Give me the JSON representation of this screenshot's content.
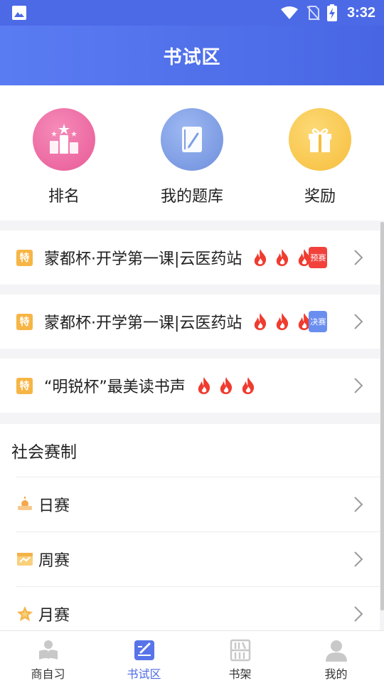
{
  "status_bar": {
    "time": "3:32"
  },
  "header": {
    "title": "书试区"
  },
  "quick_actions": [
    {
      "label": "排名",
      "icon": "podium-stars-icon",
      "color": "#ee6ea5"
    },
    {
      "label": "我的题库",
      "icon": "notebook-pen-icon",
      "color": "#7d9fe6"
    },
    {
      "label": "奖励",
      "icon": "gift-box-icon",
      "color": "#f9c84d"
    }
  ],
  "contests": [
    {
      "tag": "特",
      "title": "蒙都杯·开学第一课|云医药站",
      "flames": 3,
      "badge": "预赛",
      "badge_color": "#f2413b"
    },
    {
      "tag": "特",
      "title": "蒙都杯·开学第一课|云医药站",
      "flames": 3,
      "badge": "决赛",
      "badge_color": "#6a8ef0"
    },
    {
      "tag": "特",
      "title": "“明锐杯”最美读书声",
      "flames": 3,
      "badge": "",
      "badge_color": ""
    }
  ],
  "social": {
    "title": "社会赛制",
    "items": [
      {
        "label": "日赛",
        "icon": "sunrise-icon"
      },
      {
        "label": "周赛",
        "icon": "calendar-week-icon"
      },
      {
        "label": "月赛",
        "icon": "star-medal-icon"
      }
    ]
  },
  "tabs": [
    {
      "label": "商自习",
      "icon": "reader-icon",
      "active": false
    },
    {
      "label": "书试区",
      "icon": "exam-paper-icon",
      "active": true
    },
    {
      "label": "书架",
      "icon": "bookshelf-icon",
      "active": false
    },
    {
      "label": "我的",
      "icon": "person-icon",
      "active": false
    }
  ],
  "colors": {
    "primary": "#4c69e6",
    "flame": "#f03b2f",
    "tag": "#f6b544"
  }
}
